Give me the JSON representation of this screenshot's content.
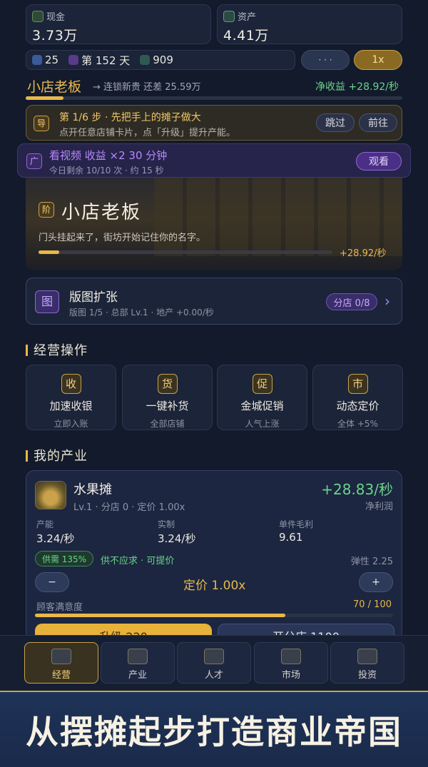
{
  "top": {
    "cash_label": "现金",
    "cash_value": "3.73万",
    "assets_label": "资产",
    "assets_value": "4.41万"
  },
  "resources": {
    "gems": "25",
    "day": "第 152 天",
    "points": "909",
    "more": "· · ·",
    "speed": "1x"
  },
  "rank": {
    "title": "小店老板",
    "next": "→ 连锁新贵 还差 25.59万",
    "income": "净收益 +28.92/秒",
    "progress": 0.1
  },
  "guide": {
    "badge": "导",
    "title": "第 1/6 步 · 先把手上的摊子做大",
    "desc": "点开任意店铺卡片，点「升级」提升产能。",
    "skip": "跳过",
    "go": "前往"
  },
  "ad": {
    "badge": "广",
    "title": "看视频 收益 ×2 30 分钟",
    "desc": "今日剩余 10/10 次 · 约 15 秒",
    "watch": "观看"
  },
  "banner": {
    "badge": "阶",
    "title": "小店老板",
    "desc": "门头挂起来了，街坊开始记住你的名字。",
    "rate": "+28.92/秒",
    "progress": 0.07
  },
  "territory": {
    "icon": "图",
    "title": "版图扩张",
    "desc": "版图 1/5 · 总部 Lv.1 · 地产 +0.00/秒",
    "branch": "分店 0/8"
  },
  "ops_title": "经营操作",
  "ops": [
    {
      "icon": "收",
      "label": "加速收银",
      "sub": "立即入账"
    },
    {
      "icon": "货",
      "label": "一键补货",
      "sub": "全部店铺"
    },
    {
      "icon": "促",
      "label": "金城促销",
      "sub": "人气上涨"
    },
    {
      "icon": "市",
      "label": "动态定价",
      "sub": "全体 +5%"
    }
  ],
  "industry_title": "我的产业",
  "shop": {
    "name": "水果摊",
    "meta": "Lv.1 · 分店 0 · 定价 1.00x",
    "income": "+28.83/秒",
    "income_sub": "净利润",
    "h1": "产能",
    "v1": "3.24/秒",
    "h2": "实制",
    "v2": "3.24/秒",
    "h3": "单件毛利",
    "v3": "9.61",
    "supply": "供需 135%",
    "supply_note": "供不应求 · 可提价",
    "elasticity": "弹性 2.25",
    "minus": "−",
    "price": "定价 1.00x",
    "plus": "+",
    "sat_label": "顾客满意度",
    "sat_value": "70 / 100",
    "satisfaction": 0.7,
    "upgrade": "升级 220",
    "branch_btn": "开分店 1100"
  },
  "nav": [
    {
      "label": "经营"
    },
    {
      "label": "产业"
    },
    {
      "label": "人才"
    },
    {
      "label": "市场"
    },
    {
      "label": "投资"
    }
  ],
  "slogan": "从摆摊起步打造商业帝国",
  "colors": {
    "accent": "#e8b84a",
    "green": "#6cd38a",
    "purple": "#b07af0"
  }
}
